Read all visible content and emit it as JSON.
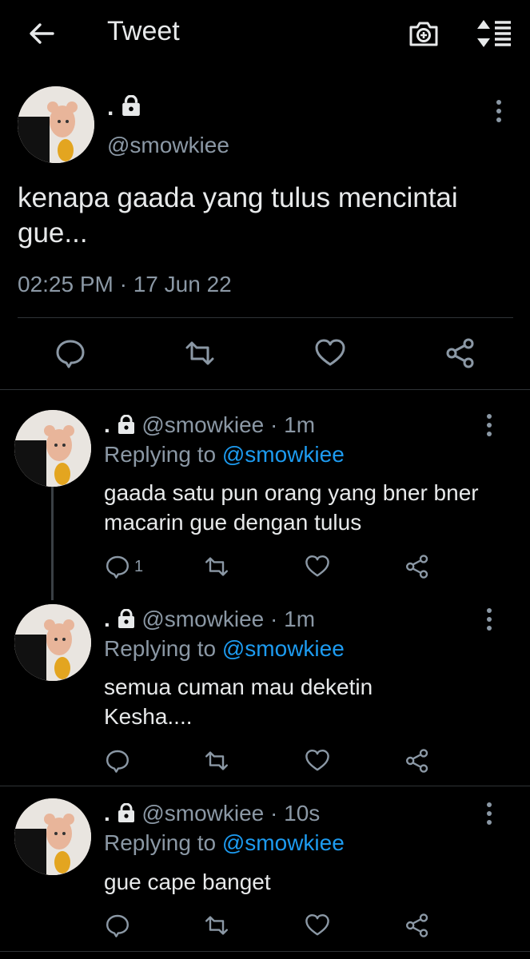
{
  "header": {
    "title": "Tweet",
    "icons": [
      "back-arrow-icon",
      "camera-plus-icon",
      "sort-icon"
    ]
  },
  "main_tweet": {
    "name": ".",
    "handle": "@smowkiee",
    "text": "kenapa gaada yang tulus mencintai gue...",
    "timestamp": "02:25 PM · 17 Jun 22"
  },
  "replies": [
    {
      "name": ".",
      "handle": "@smowkiee",
      "time": "1m",
      "replying_label": "Replying to",
      "replying_to": "@smowkiee",
      "text": "gaada satu pun orang yang bner bner macarin gue dengan tulus",
      "reply_count": "1"
    },
    {
      "name": ".",
      "handle": "@smowkiee",
      "time": "1m",
      "replying_label": "Replying to",
      "replying_to": "@smowkiee",
      "text": "semua cuman mau deketin Kesha....",
      "reply_count": ""
    },
    {
      "name": ".",
      "handle": "@smowkiee",
      "time": "10s",
      "replying_label": "Replying to",
      "replying_to": "@smowkiee",
      "text": "gue cape banget",
      "reply_count": ""
    }
  ],
  "colors": {
    "background": "#000000",
    "text": "#e7e9ea",
    "muted": "#8b98a5",
    "accent": "#1d9bf0",
    "divider": "#2f3336"
  }
}
